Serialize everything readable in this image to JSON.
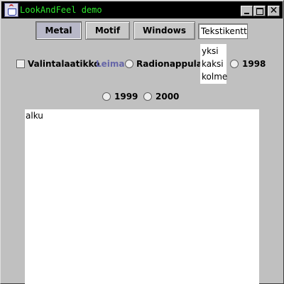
{
  "window": {
    "title": "LookAndFeel demo",
    "title_color": "#2ee82e",
    "controls": {
      "minimize_icon": "minimize-icon",
      "maximize_icon": "maximize-icon",
      "close_label": "✕"
    }
  },
  "lnf_buttons": [
    {
      "label": "Metal",
      "pressed": true
    },
    {
      "label": "Motif",
      "pressed": false
    },
    {
      "label": "Windows",
      "pressed": false
    }
  ],
  "textfield": {
    "value": "Tekstikenttä"
  },
  "checkbox": {
    "label": "Valintalaatikko",
    "checked": false
  },
  "label_leima": {
    "text": "Leima",
    "color": "#6666a8"
  },
  "radios": [
    {
      "label": "Radionappula",
      "checked": false
    },
    {
      "label": "1998",
      "checked": false
    },
    {
      "label": "1999",
      "checked": false
    },
    {
      "label": "2000",
      "checked": false
    }
  ],
  "list": {
    "items": [
      "yksi",
      "kaksi",
      "kolme"
    ]
  },
  "textarea": {
    "value": "alku"
  }
}
